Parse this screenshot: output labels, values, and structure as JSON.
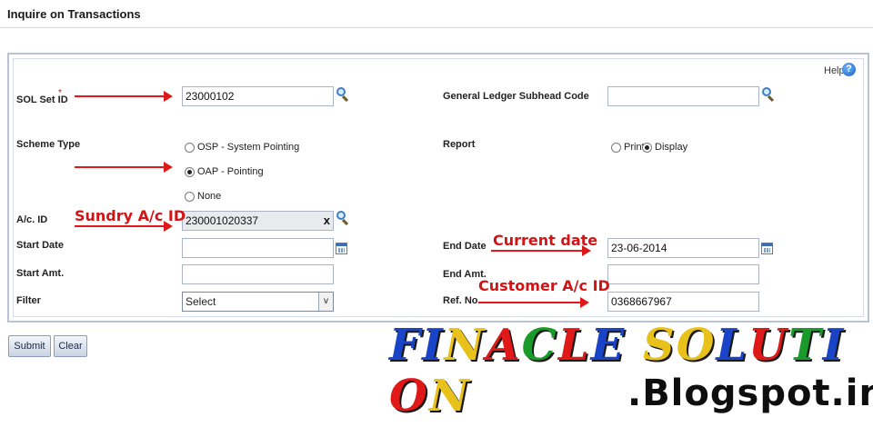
{
  "page": {
    "title": "Inquire on Transactions"
  },
  "help": {
    "label": "Help",
    "icon": "?"
  },
  "left": {
    "sol_label": "SOL Set ID",
    "sol_required": "*",
    "sol_value": "23000102",
    "scheme_label": "Scheme Type",
    "scheme_options": [
      "OSP - System Pointing",
      "OAP - Pointing",
      "None"
    ],
    "scheme_selected": "OAP - Pointing",
    "acid_label": "A/c. ID",
    "acid_value": "230001020337",
    "acid_clear": "x",
    "start_date_label": "Start Date",
    "start_date_value": "",
    "start_amt_label": "Start Amt.",
    "start_amt_value": "",
    "filter_label": "Filter",
    "filter_value": "Select",
    "filter_caret": "v"
  },
  "right": {
    "gl_label": "General Ledger Subhead Code",
    "gl_value": "",
    "report_label": "Report",
    "report_options": [
      "Print",
      "Display"
    ],
    "report_selected": "Display",
    "end_date_label": "End Date",
    "end_date_value": "23-06-2014",
    "end_amt_label": "End Amt.",
    "end_amt_value": "",
    "ref_label": "Ref. No.",
    "ref_value": "0368667967"
  },
  "buttons": {
    "submit": "Submit",
    "clear": "Clear"
  },
  "annotations": {
    "sundry": "Sundry A/c ID",
    "current_date": "Current date",
    "customer": "Customer A/c ID",
    "color": "#d41414"
  },
  "watermark": {
    "title": "FINACLE SOLUTION",
    "subtitle": ".Blogspot.in",
    "letter_colors": [
      "#1a44c8",
      "#1a44c8",
      "#e8c21a",
      "#e01818",
      "#1a9a2a",
      "#e01818",
      "#1a44c8",
      "#e8c21a",
      "#e8c21a",
      "#1a44c8",
      "#e01818",
      "#1a9a2a",
      "#1a44c8",
      "#e01818",
      "#e8c21a"
    ]
  },
  "icons": {
    "lookup": "search-icon",
    "calendar": "calendar-icon"
  }
}
